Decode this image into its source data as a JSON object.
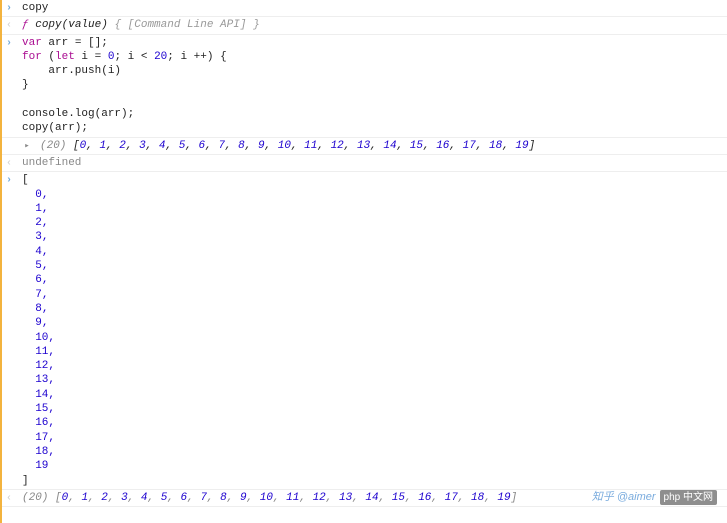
{
  "entries": {
    "copy_cmd": "copy",
    "copy_sig": {
      "kw": "ƒ",
      "name": "copy",
      "params": "(value)",
      "rest": " { [Command Line API] }"
    },
    "code": {
      "line1_pre": "var",
      "line1_post": " arr = [];",
      "line2_for": "for",
      "line2_open": " (",
      "line2_let": "let",
      "line2_i": " i = ",
      "line2_zero": "0",
      "line2_semi1": "; i < ",
      "line2_twenty": "20",
      "line2_semi2": "; i ++) {",
      "line3": "    arr.push(i)",
      "line4": "}",
      "line5": "",
      "line6": "console.log(arr);",
      "line7": "copy(arr);"
    },
    "array_preview": {
      "len": "(20) ",
      "values": [
        0,
        1,
        2,
        3,
        4,
        5,
        6,
        7,
        8,
        9,
        10,
        11,
        12,
        13,
        14,
        15,
        16,
        17,
        18,
        19
      ]
    },
    "undefined_txt": "undefined",
    "expanded": {
      "open": "[",
      "items": [
        "0",
        "1",
        "2",
        "3",
        "4",
        "5",
        "6",
        "7",
        "8",
        "9",
        "10",
        "11",
        "12",
        "13",
        "14",
        "15",
        "16",
        "17",
        "18",
        "19"
      ],
      "close": "]"
    },
    "grey_output": {
      "len": "(20) ",
      "values": [
        0,
        1,
        2,
        3,
        4,
        5,
        6,
        7,
        8,
        9,
        10,
        11,
        12,
        13,
        14,
        15,
        16,
        17,
        18,
        19
      ]
    }
  },
  "watermark": {
    "zhihu": "知乎 @aimer",
    "php": "php 中文网"
  }
}
